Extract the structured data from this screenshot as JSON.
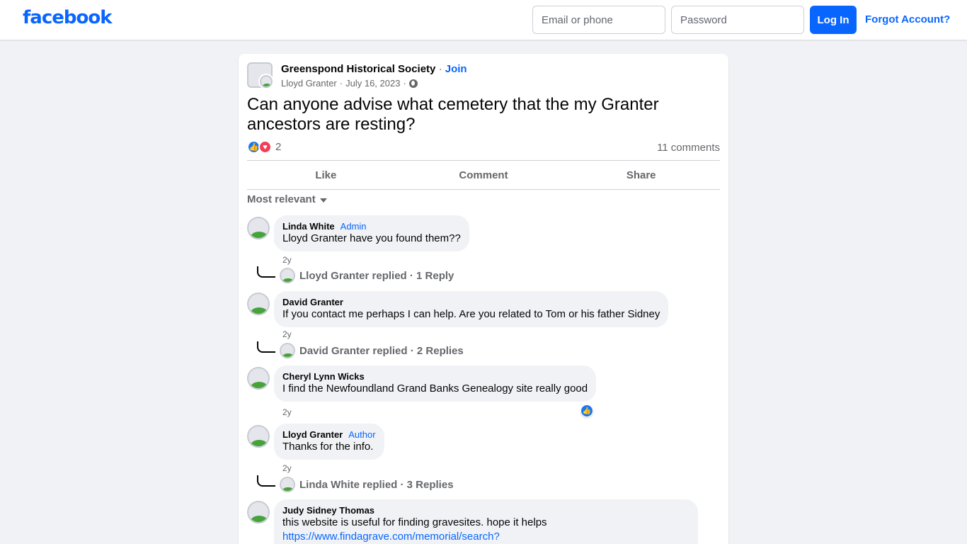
{
  "header": {
    "logo": "facebook",
    "email_placeholder": "Email or phone",
    "password_placeholder": "Password",
    "login_label": "Log In",
    "forgot_label": "Forgot Account?"
  },
  "post": {
    "group_name": "Greenspond Historical Society",
    "separator": "·",
    "join_label": "Join",
    "author": "Lloyd Granter",
    "date": "July 16, 2023",
    "meta_sep": "·",
    "text": "Can anyone advise what cemetery that the my Granter ancestors are resting?",
    "reaction_count": "2",
    "comments_count": "11 comments",
    "actions": {
      "like": "Like",
      "comment": "Comment",
      "share": "Share"
    },
    "sort_label": "Most relevant"
  },
  "comments": [
    {
      "name": "Linda White",
      "badge": "Admin",
      "text": "Lloyd Granter have you found them??",
      "time": "2y",
      "reply_summary": "Lloyd Granter replied · 1 Reply"
    },
    {
      "name": "David Granter",
      "text": "If you contact me perhaps I can help. Are you related to Tom or his father Sidney",
      "time": "2y",
      "reply_summary": "David Granter replied · 2 Replies"
    },
    {
      "name": "Cheryl Lynn Wicks",
      "text": "I find the Newfoundland Grand Banks Genealogy site really good",
      "time": "2y"
    },
    {
      "name": "Lloyd Granter",
      "badge": "Author",
      "text": "Thanks for the info.",
      "time": "2y",
      "reply_summary": "Linda White replied · 3 Replies"
    },
    {
      "name": "Judy Sidney Thomas",
      "text": "this website is useful for finding gravesites. hope it helps",
      "link": "https://www.findagrave.com/memorial/search?"
    }
  ],
  "colors": {
    "brand": "#0866ff",
    "like": "#1877f2",
    "love": "#f33e58",
    "muted": "#65676b"
  },
  "icons": [
    "globe-icon",
    "like-reaction-icon",
    "love-reaction-icon",
    "caret-down-icon",
    "avatar-icon"
  ]
}
